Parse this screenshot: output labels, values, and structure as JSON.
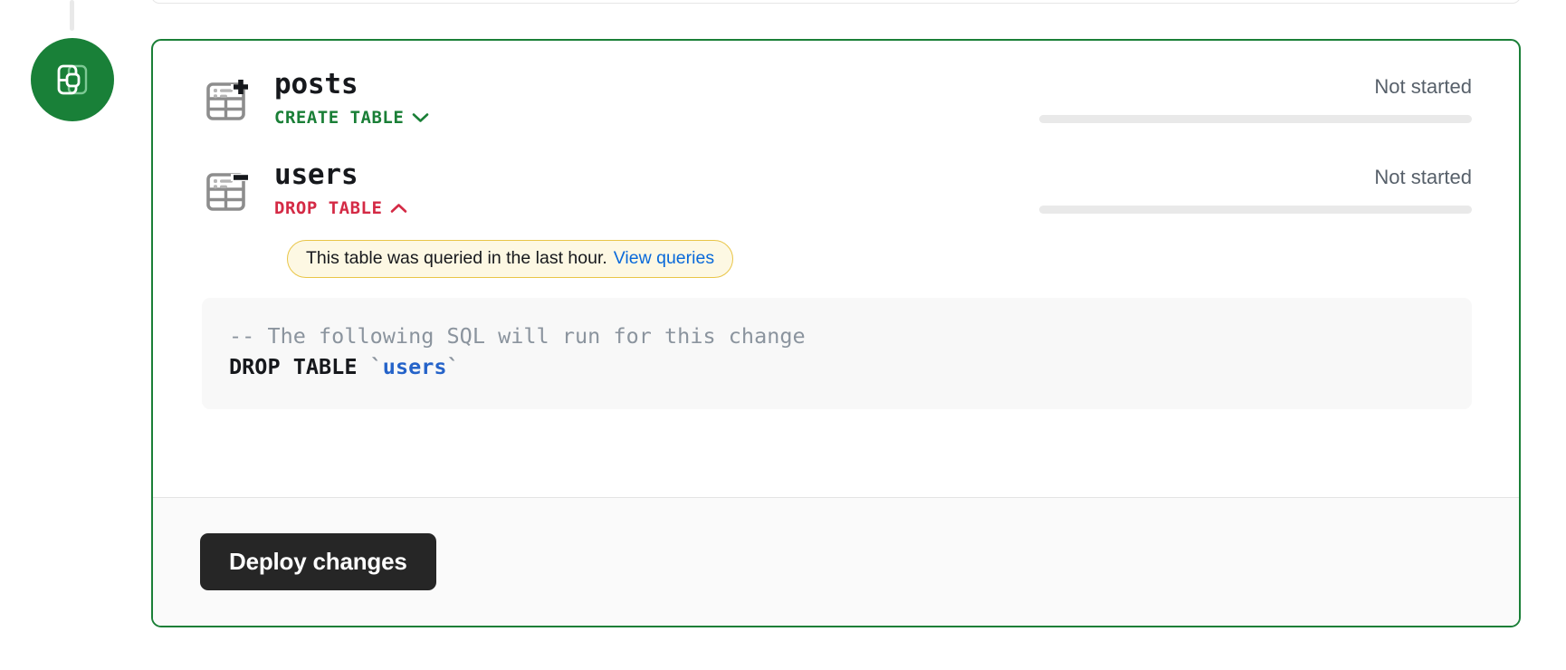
{
  "branding": {
    "badge_icon": "database-branch-icon",
    "badge_color": "#198038",
    "connector_icon": "vertical-connector-line"
  },
  "card": {
    "border_color": "#1a7f37",
    "changes": [
      {
        "table_name": "posts",
        "icon": "table-add-icon",
        "operation": "CREATE TABLE",
        "operation_color": "#1a7f37",
        "chevron": "chevron-down-icon",
        "expanded": false,
        "status": "Not started",
        "progress_percent": 0
      },
      {
        "table_name": "users",
        "icon": "table-remove-icon",
        "operation": "DROP TABLE",
        "operation_color": "#d42a45",
        "chevron": "chevron-up-icon",
        "expanded": true,
        "status": "Not started",
        "progress_percent": 0,
        "warning": {
          "message": "This table was queried in the last hour.",
          "link_label": "View queries",
          "background": "#fdf8e3",
          "border": "#e9c547",
          "link_color": "#0969da"
        },
        "sql": {
          "comment": "-- The following SQL will run for this change",
          "keyword": "DROP TABLE",
          "identifier": "users",
          "backtick": "`"
        }
      }
    ]
  },
  "footer": {
    "deploy_label": "Deploy changes",
    "button_color": "#262626"
  }
}
